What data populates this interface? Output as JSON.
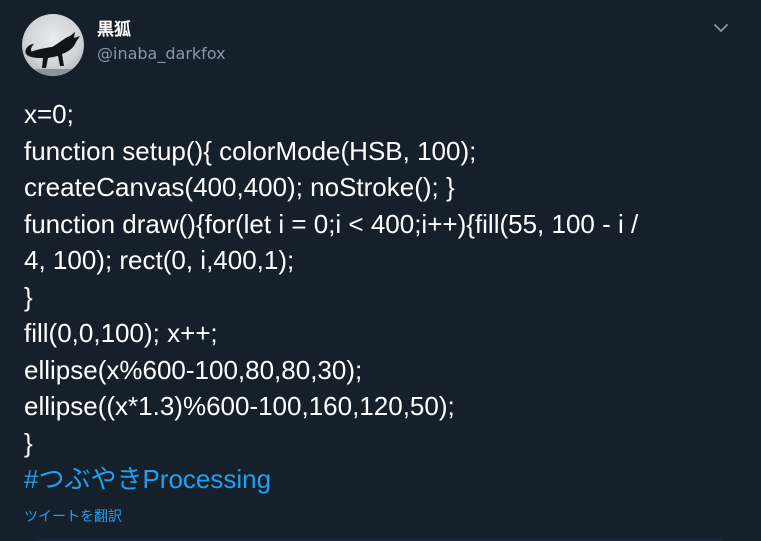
{
  "user": {
    "display_name": "黒狐",
    "handle": "@inaba_darkfox"
  },
  "tweet": {
    "lines": [
      "x=0;",
      "function setup(){ colorMode(HSB, 100);",
      "createCanvas(400,400); noStroke(); }",
      "function draw(){for(let i = 0;i < 400;i++){fill(55, 100 - i /",
      "4, 100); rect(0, i,400,1);",
      "}",
      "fill(0,0,100); x++;",
      "ellipse(x%600-100,80,80,30);",
      "ellipse((x*1.3)%600-100,160,120,50);",
      "}"
    ],
    "hashtag": "#つぶやきProcessing",
    "translate_label": "ツイートを翻訳"
  },
  "icons": {
    "menu": "chevron-down-icon",
    "avatar": "fox-silhouette-avatar"
  },
  "colors": {
    "background": "#15202b",
    "text": "#ffffff",
    "secondary_text": "#8899a6",
    "link": "#1da1f2"
  }
}
